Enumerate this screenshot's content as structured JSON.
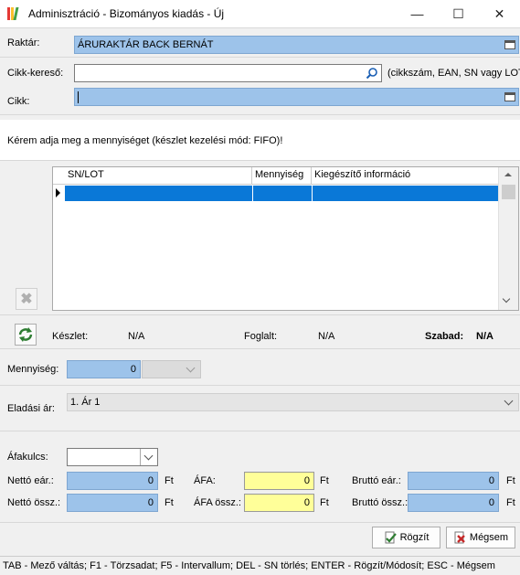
{
  "window": {
    "title": "Adminisztráció - Bizományos kiadás - Új",
    "minimize": "—",
    "maximize": "☐",
    "close": "✕"
  },
  "raktar": {
    "label": "Raktár:",
    "value": "ÁRURAKTÁR BACK BERNÁT"
  },
  "cikk_kereso": {
    "label": "Cikk-kereső:",
    "value": "",
    "hint": "(cikkszám, EAN, SN vagy LOT)"
  },
  "cikk": {
    "label": "Cikk:",
    "value": ""
  },
  "message": "Kérem adja meg a mennyiséget (készlet kezelési mód: FIFO)!",
  "grid": {
    "columns": [
      "SN/LOT",
      "Mennyiség",
      "Kiegészítő információ"
    ],
    "rows": [
      [
        "",
        "",
        ""
      ]
    ]
  },
  "stock": {
    "keszlet_label": "Készlet:",
    "keszlet_value": "N/A",
    "foglalt_label": "Foglalt:",
    "foglalt_value": "N/A",
    "szabad_label": "Szabad:",
    "szabad_value": "N/A"
  },
  "mennyiseg": {
    "label": "Mennyiség:",
    "value": "0",
    "unit": ""
  },
  "eladasi_ar": {
    "label": "Eladási ár:",
    "value": "1. Ár 1"
  },
  "afakulcs": {
    "label": "Áfakulcs:",
    "value": ""
  },
  "prices": {
    "netto_ear": {
      "label": "Nettó eár.:",
      "value": "0",
      "currency": "Ft"
    },
    "afa": {
      "label": "ÁFA:",
      "value": "0",
      "currency": "Ft"
    },
    "brutto_ear": {
      "label": "Bruttó eár.:",
      "value": "0",
      "currency": "Ft"
    },
    "netto_ossz": {
      "label": "Nettó össz.:",
      "value": "0",
      "currency": "Ft"
    },
    "afa_ossz": {
      "label": "ÁFA össz.:",
      "value": "0",
      "currency": "Ft"
    },
    "brutto_ossz": {
      "label": "Bruttó össz.:",
      "value": "0",
      "currency": "Ft"
    }
  },
  "buttons": {
    "save": "Rögzít",
    "cancel": "Mégsem"
  },
  "statusbar": "TAB - Mező váltás; F1 - Törzsadat; F5 - Intervallum; DEL - SN törlés; ENTER - Rögzít/Módosít; ESC - Mégsem",
  "colors": {
    "field_blue": "#9dc3ea",
    "selection": "#0a78d7",
    "yellow": "#ffff99"
  }
}
